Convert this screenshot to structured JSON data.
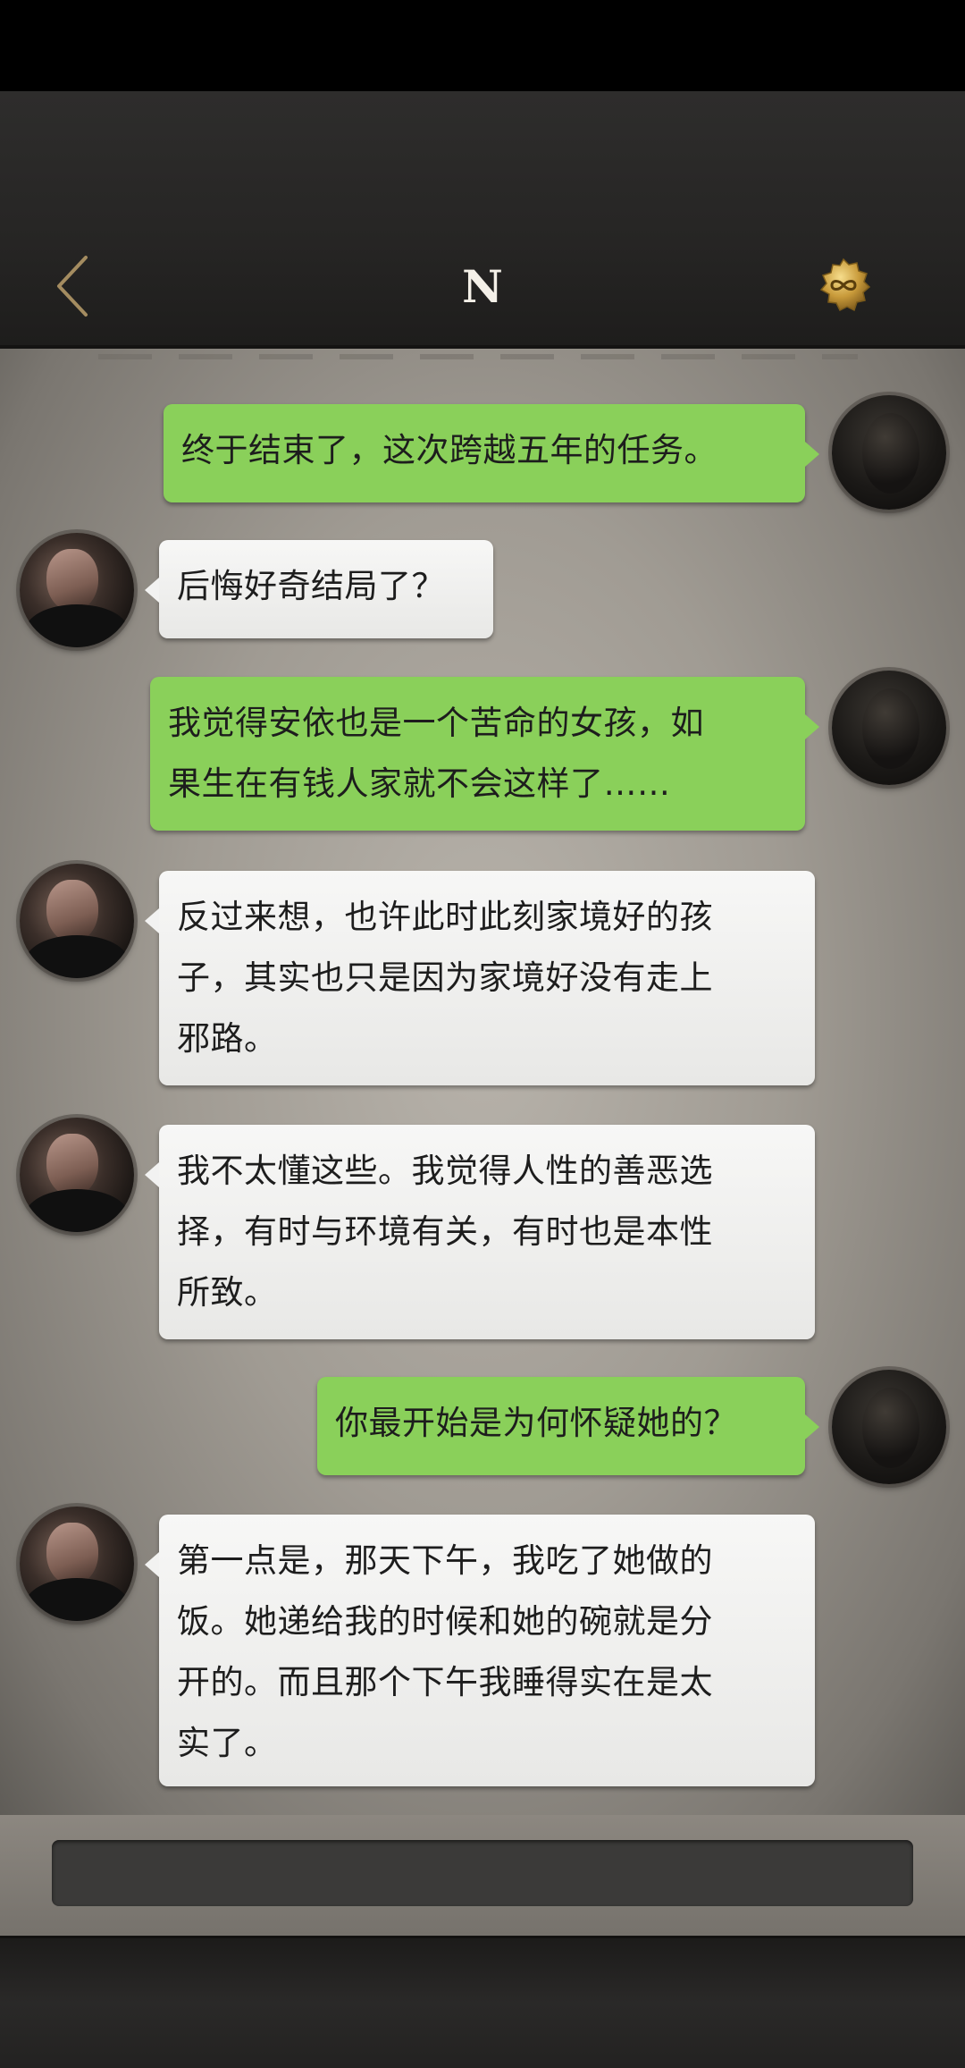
{
  "header": {
    "title": "N",
    "back_icon": "chevron-left-icon",
    "coin_icon": "infinity-coin-icon",
    "accent_color": "#b49a6a"
  },
  "messages": [
    {
      "side": "right",
      "text": "终于结束了，这次跨越五年的任务。"
    },
    {
      "side": "left",
      "text": "后悔好奇结局了？"
    },
    {
      "side": "right",
      "lines": [
        "我觉得安依也是一个苦命的女孩，如",
        "果生在有钱人家就不会这样了……"
      ]
    },
    {
      "side": "left",
      "lines": [
        "反过来想，也许此时此刻家境好的孩",
        "子，其实也只是因为家境好没有走上",
        "邪路。"
      ]
    },
    {
      "side": "left",
      "lines": [
        "我不太懂这些。我觉得人性的善恶选",
        "择，有时与环境有关，有时也是本性",
        "所致。"
      ]
    },
    {
      "side": "right",
      "text": "你最开始是为何怀疑她的？"
    },
    {
      "side": "left",
      "lines": [
        "第一点是，那天下午，我吃了她做的",
        "饭。她递给我的时候和她的碗就是分",
        "开的。而且那个下午我睡得实在是太",
        "实了。"
      ]
    }
  ],
  "input": {
    "value": "",
    "placeholder": ""
  },
  "colors": {
    "bubble_right": "#8ad05a",
    "bubble_left": "#eeeeec",
    "header": "#2a2928"
  }
}
